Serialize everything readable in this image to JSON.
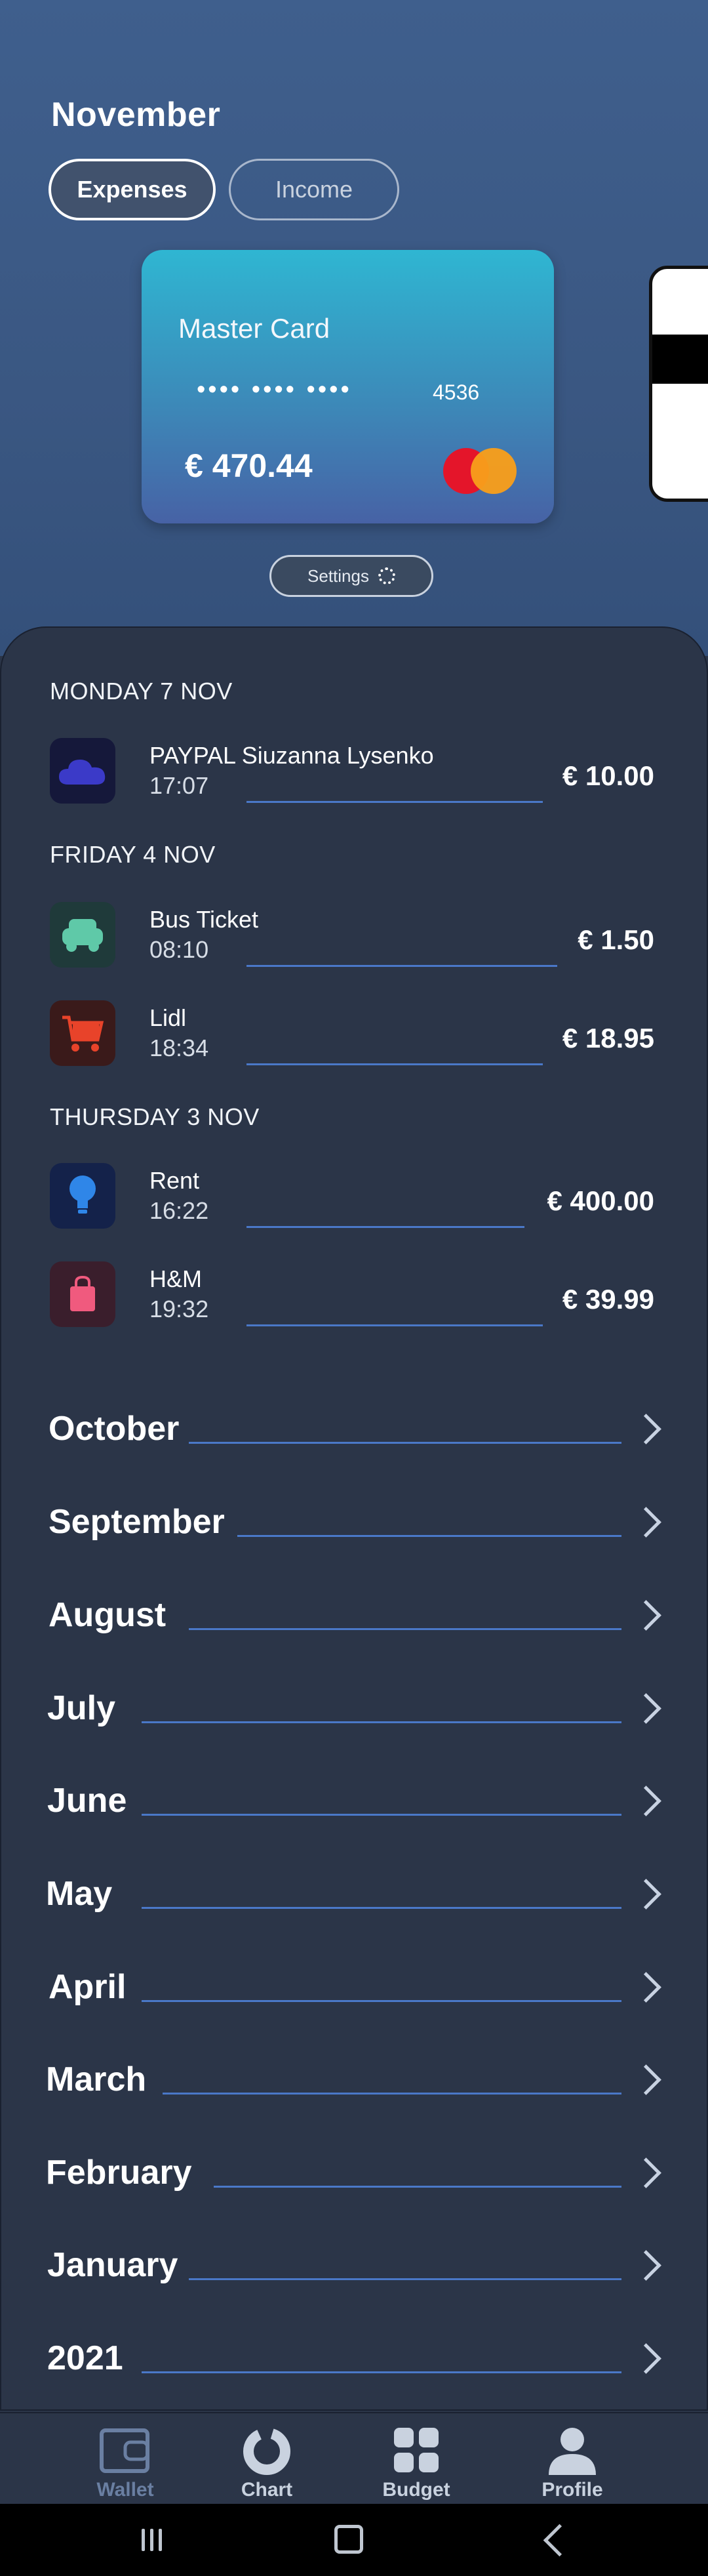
{
  "header": {
    "month": "November"
  },
  "segments": {
    "expenses": "Expenses",
    "income": "Income"
  },
  "card": {
    "brand": "Master Card",
    "masked": "•••• •••• ••••",
    "last4": "4536",
    "balance": "€ 470.44"
  },
  "settings_label": "Settings",
  "days": [
    {
      "label": "MONDAY 7 NOV",
      "transactions": [
        {
          "icon": "cloud-icon",
          "name": "PAYPAL Siuzanna Lysenko",
          "time": "17:07",
          "amount": "€ 10.00"
        }
      ]
    },
    {
      "label": "FRIDAY 4 NOV",
      "transactions": [
        {
          "icon": "car-icon",
          "name": "Bus Ticket",
          "time": "08:10",
          "amount": "€ 1.50"
        },
        {
          "icon": "cart-icon",
          "name": "Lidl",
          "time": "18:34",
          "amount": "€ 18.95"
        }
      ]
    },
    {
      "label": "THURSDAY 3 NOV",
      "transactions": [
        {
          "icon": "lightbulb-icon",
          "name": "Rent",
          "time": "16:22",
          "amount": "€ 400.00"
        },
        {
          "icon": "shopping-bag-icon",
          "name": "H&M",
          "time": "19:32",
          "amount": "€ 39.99"
        }
      ]
    }
  ],
  "months": [
    "October",
    "September",
    "August",
    "July",
    "June",
    "May",
    "April",
    "March",
    "February",
    "January",
    "2021"
  ],
  "nav": {
    "wallet": "Wallet",
    "chart": "Chart",
    "budget": "Budget",
    "profile": "Profile"
  },
  "colors": {
    "accent_line": "#4a78c8",
    "background": "#2b3548",
    "header_bg": "#3f5f8d"
  }
}
